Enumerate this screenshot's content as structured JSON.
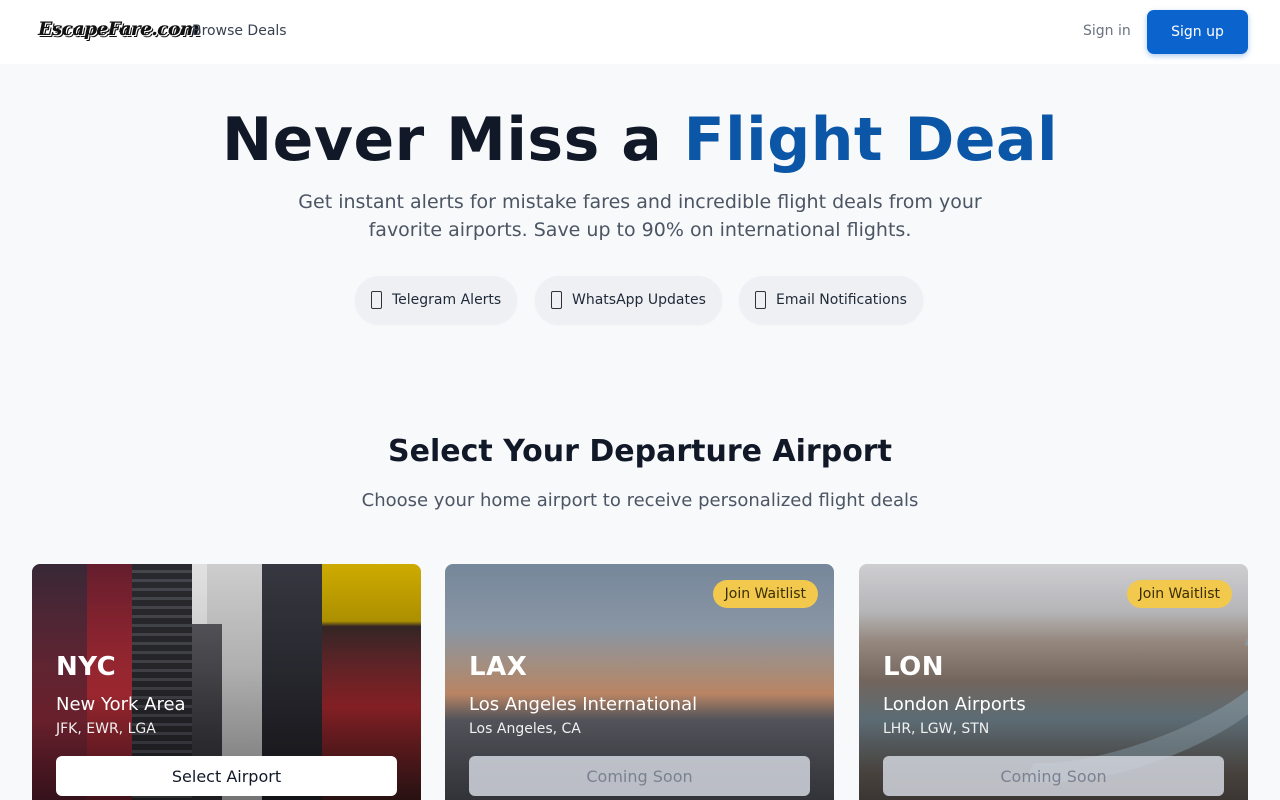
{
  "header": {
    "logo_text": "EscapeFare.com",
    "nav_browse": "Browse Deals",
    "sign_in": "Sign in",
    "sign_up": "Sign up"
  },
  "hero": {
    "title_main": "Never Miss a",
    "title_accent": "Flight Deal",
    "subtitle": "Get instant alerts for mistake fares and incredible flight deals from your favorite airports. Save up to 90% on international flights.",
    "channels": [
      {
        "label": "Telegram Alerts",
        "icon": "phone-icon"
      },
      {
        "label": "WhatsApp Updates",
        "icon": "phone-icon"
      },
      {
        "label": "Email Notifications",
        "icon": "phone-icon"
      }
    ]
  },
  "airports_section": {
    "title": "Select Your Departure Airport",
    "subtitle": "Choose your home airport to receive personalized flight deals"
  },
  "airports": [
    {
      "code": "NYC",
      "name": "New York Area",
      "detail": "JFK, EWR, LGA",
      "button": "Select Airport",
      "badge": ""
    },
    {
      "code": "LAX",
      "name": "Los Angeles International",
      "detail": "Los Angeles, CA",
      "button": "Coming Soon",
      "badge": "Join Waitlist"
    },
    {
      "code": "LON",
      "name": "London Airports",
      "detail": "LHR, LGW, STN",
      "button": "Coming Soon",
      "badge": "Join Waitlist"
    }
  ],
  "colors": {
    "brand_blue": "#0b63ce",
    "accent_text": "#0b56a6",
    "badge_yellow": "#f2c94c"
  }
}
